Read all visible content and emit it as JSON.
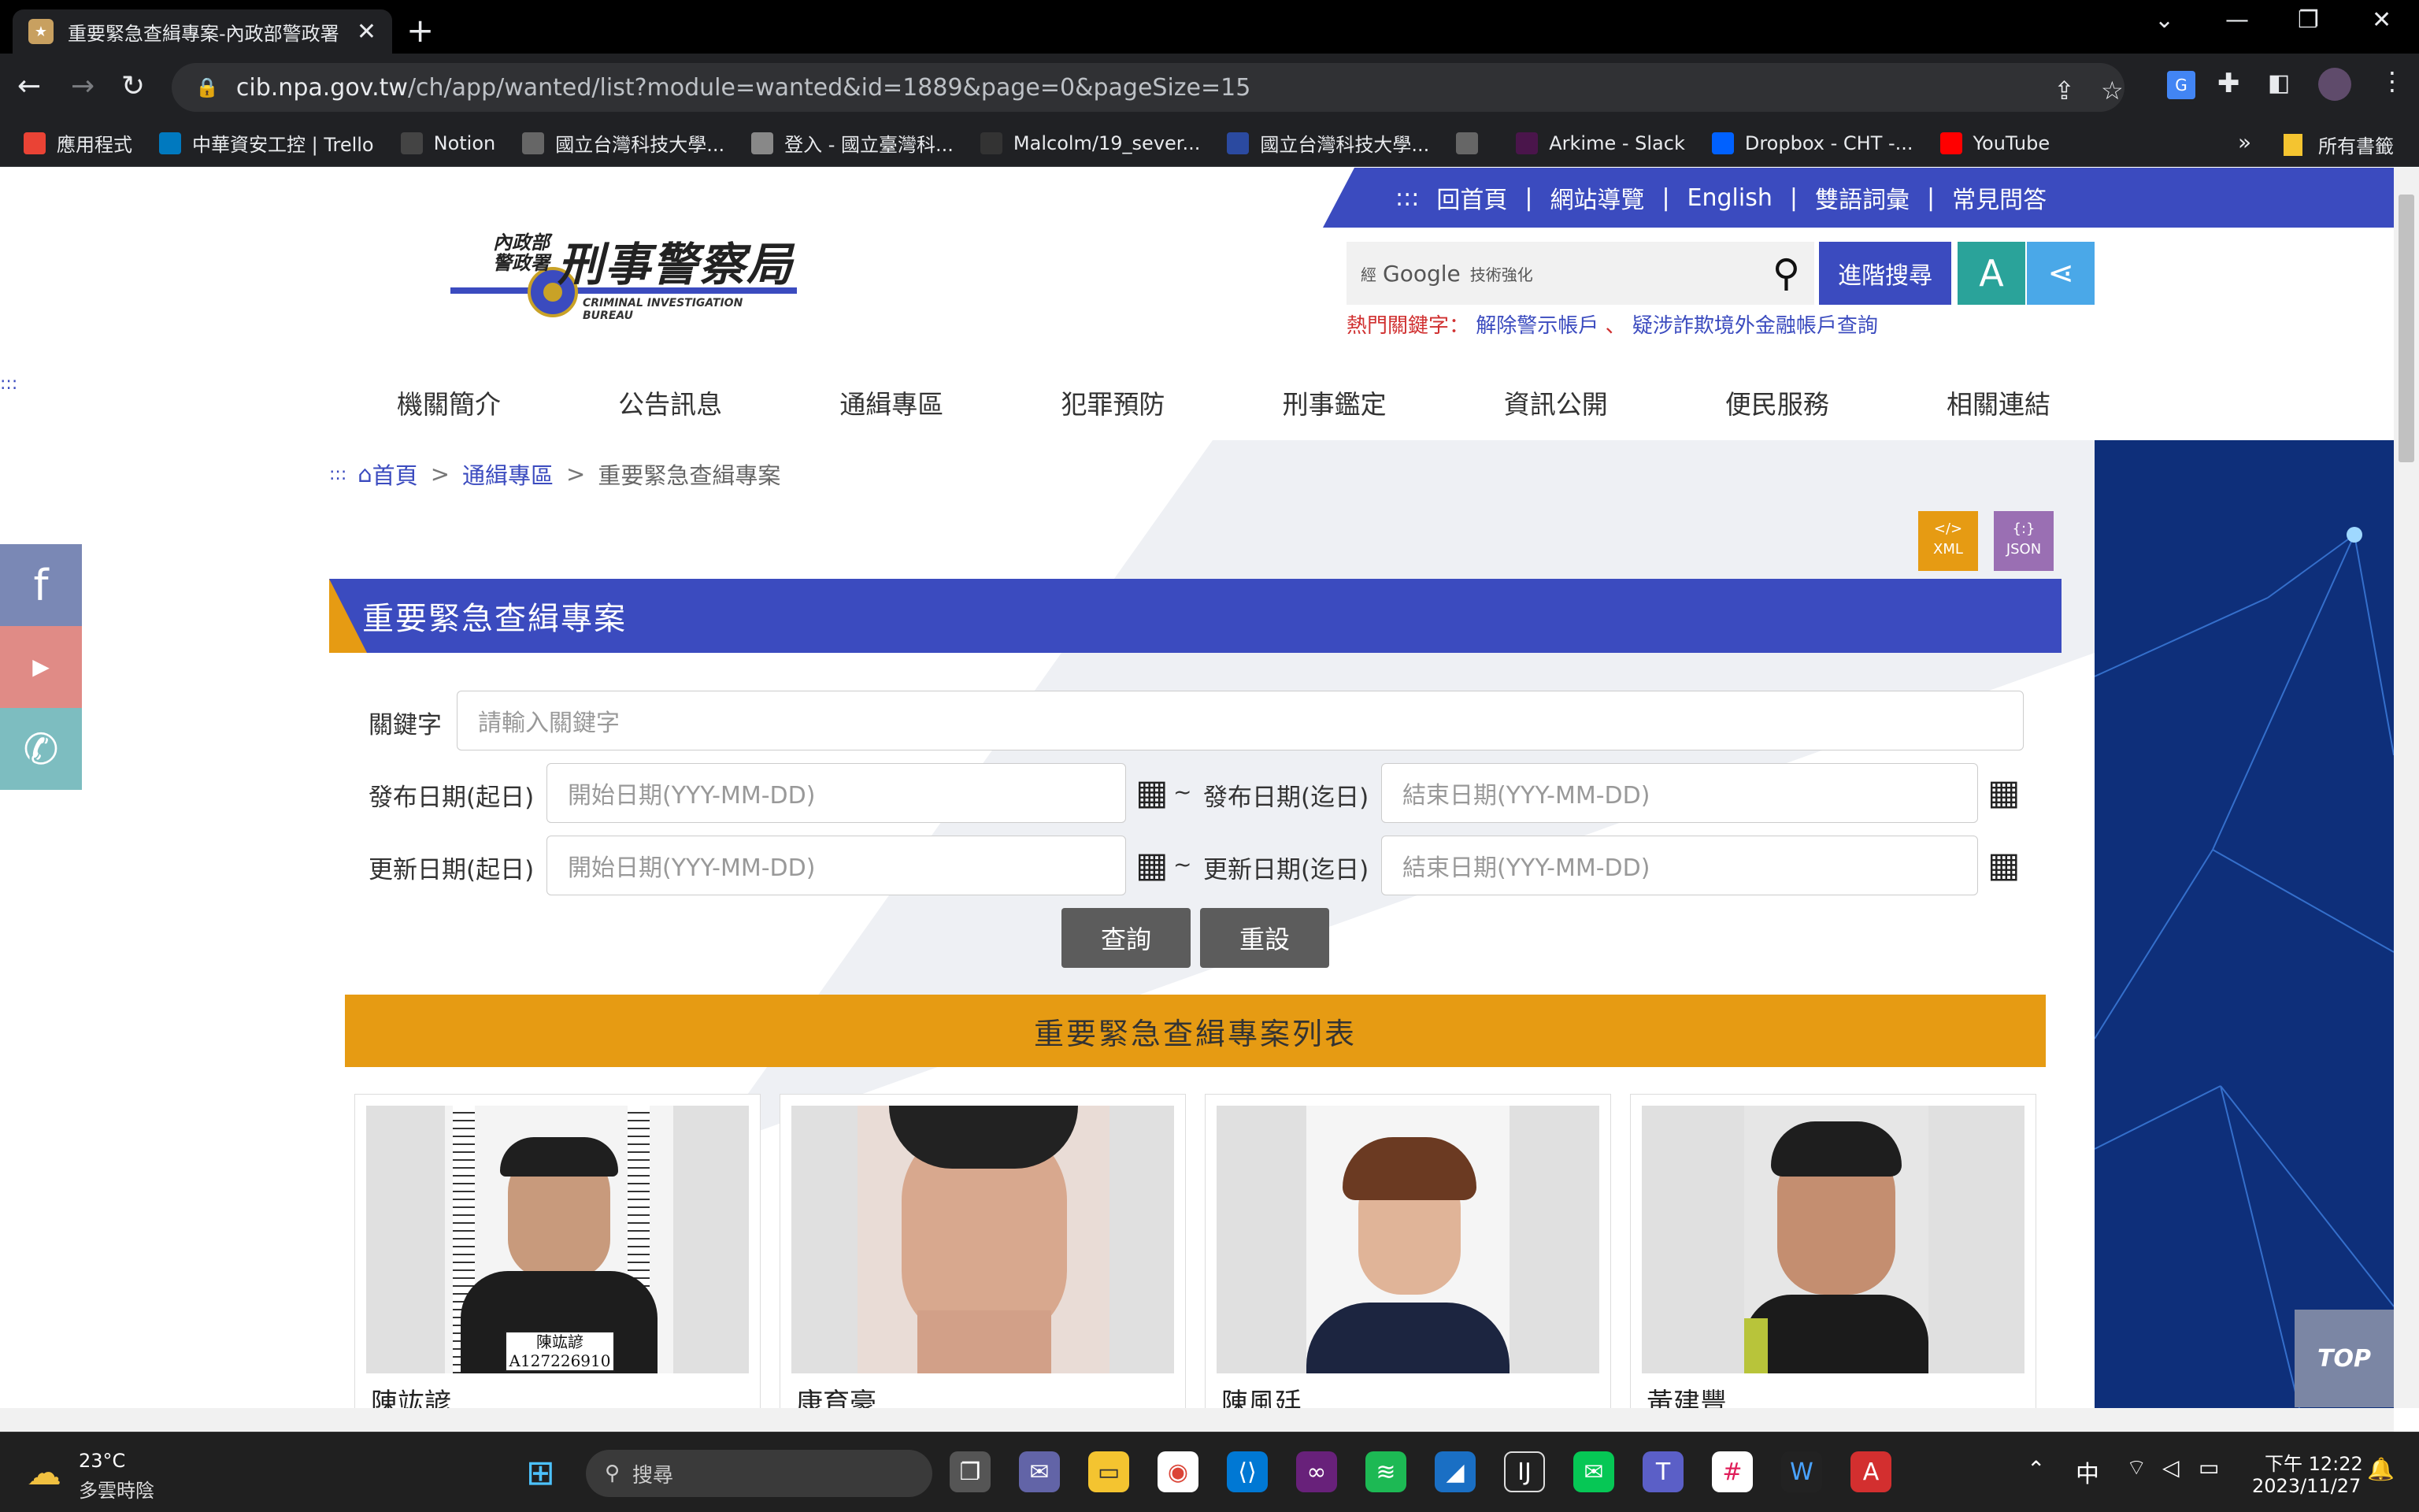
{
  "browser": {
    "tab_title": "重要緊急查緝專案-內政部警政署",
    "tab_close": "✕",
    "new_tab": "+",
    "url_host": "cib.npa.gov.tw",
    "url_path": "/ch/app/wanted/list?module=wanted&id=1889&page=0&pageSize=15",
    "bookmarks": [
      {
        "label": "應用程式",
        "color": "#ea4335",
        "icon": "apps-icon"
      },
      {
        "label": "中華資安工控 | Trello",
        "color": "#0079bf",
        "icon": "trello-icon"
      },
      {
        "label": "Notion",
        "color": "#444444",
        "icon": "notion-icon"
      },
      {
        "label": "國立台灣科技大學...",
        "color": "#666666",
        "icon": "globe-icon"
      },
      {
        "label": "登入 - 國立臺灣科...",
        "color": "#888888",
        "icon": "doc-icon"
      },
      {
        "label": "Malcolm/19_sever...",
        "color": "#333333",
        "icon": "github-icon"
      },
      {
        "label": "國立台灣科技大學...",
        "color": "#2b4aa0",
        "icon": "ntust-icon"
      },
      {
        "label": "",
        "color": "#666666",
        "icon": "globe-icon"
      },
      {
        "label": "Arkime - Slack",
        "color": "#4a154b",
        "icon": "slack-icon"
      },
      {
        "label": "Dropbox - CHT -...",
        "color": "#0061ff",
        "icon": "dropbox-icon"
      },
      {
        "label": "YouTube",
        "color": "#ff0000",
        "icon": "youtube-icon"
      }
    ],
    "bookmarks_more": "»",
    "all_bookmarks": "所有書籤"
  },
  "site": {
    "top_links": [
      ":::",
      "回首頁",
      "|",
      "網站導覽",
      "|",
      "English",
      "|",
      "雙語詞彙",
      "|",
      "常見問答"
    ],
    "logo_title": "刑事警察局",
    "logo_org": "內政部警政署",
    "logo_en": "CRIMINAL INVESTIGATION BUREAU",
    "search_brand": "Google",
    "search_prefix": "經",
    "search_suffix": "技術強化",
    "adv_search": "進階搜尋",
    "font_btn": "A",
    "hot_label": "熱門關鍵字：",
    "hot_kw1": "解除警示帳戶",
    "hot_sep": "、",
    "hot_kw2": "疑涉詐欺境外金融帳戶查詢",
    "nav": [
      "機關簡介",
      "公告訊息",
      "通緝專區",
      "犯罪預防",
      "刑事鑑定",
      "資訊公開",
      "便民服務",
      "相關連結"
    ],
    "left_marker": ":::",
    "bc_marker": ":::",
    "breadcrumb": {
      "home": "首頁",
      "section": "通緝專區",
      "current": "重要緊急查緝專案",
      "sep": ">"
    },
    "xml_label": "XML",
    "json_label": "JSON",
    "section_title": "重要緊急查緝專案",
    "form": {
      "keyword_label": "關鍵字",
      "keyword_placeholder": "請輸入關鍵字",
      "pub_start_label": "發布日期(起日)",
      "pub_end_label": "發布日期(迄日)",
      "upd_start_label": "更新日期(起日)",
      "upd_end_label": "更新日期(迄日)",
      "start_placeholder": "開始日期(YYY-MM-DD)",
      "end_placeholder": "結束日期(YYY-MM-DD)",
      "tilde": "~",
      "query_btn": "查詢",
      "reset_btn": "重設"
    },
    "list_title": "重要緊急查緝專案列表",
    "cards": [
      {
        "name": "陳竑諺",
        "placard_name": "陳竑諺",
        "placard_id": "A127226910"
      },
      {
        "name": "康育豪"
      },
      {
        "name": "陳風廷"
      },
      {
        "name": "黃建豐"
      }
    ],
    "top_btn": "TOP"
  },
  "taskbar": {
    "temp": "23°C",
    "weather": "多雲時陰",
    "search": "搜尋",
    "ime": "中",
    "time": "下午 12:22",
    "date": "2023/11/27"
  }
}
